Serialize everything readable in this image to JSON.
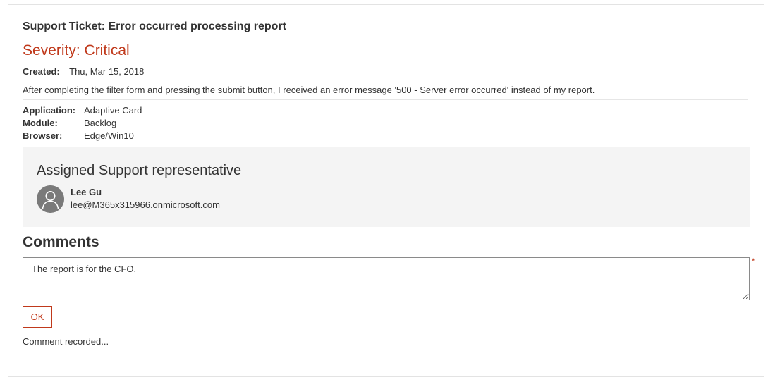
{
  "ticket": {
    "title": "Support Ticket: Error occurred processing report",
    "severity": "Severity: Critical",
    "created_label": "Created:",
    "created_value": "Thu, Mar 15, 2018",
    "description": "After completing the filter form and pressing the submit button, I received an error message '500 - Server error occurred' instead of my report.",
    "facts": [
      {
        "key": "Application:",
        "value": "Adaptive Card"
      },
      {
        "key": "Module:",
        "value": "Backlog"
      },
      {
        "key": "Browser:",
        "value": "Edge/Win10"
      }
    ]
  },
  "assigned": {
    "title": "Assigned Support representative",
    "name": "Lee Gu",
    "email": "lee@M365x315966.onmicrosoft.com",
    "avatar_icon": "person-icon"
  },
  "comments": {
    "heading": "Comments",
    "value": "The report is for the CFO.",
    "required_marker": "*",
    "submit_label": "OK",
    "status": "Comment recorded..."
  },
  "colors": {
    "accent": "#c0391b",
    "panel_bg": "#f4f4f4",
    "avatar_bg": "#7a7a7a"
  }
}
